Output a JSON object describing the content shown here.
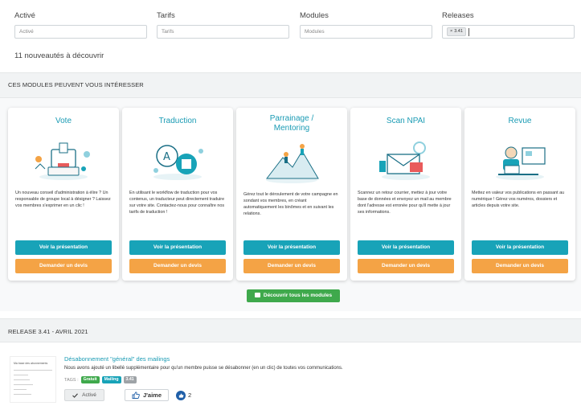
{
  "filters": [
    {
      "label": "Activé",
      "placeholder": "Activé"
    },
    {
      "label": "Tarifs",
      "placeholder": "Tarifs"
    },
    {
      "label": "Modules",
      "placeholder": "Modules"
    },
    {
      "label": "Releases",
      "chip": "3.41"
    }
  ],
  "count_text": "11 nouveautés à découvrir",
  "modules_section_title": "CES MODULES PEUVENT VOUS INTÉRESSER",
  "modules": [
    {
      "title": "Vote",
      "description": "Un nouveau conseil d'administration à élire ? Un responsable de groupe local à désigner ? Laissez vos membres s'exprimer en un clic !",
      "btn_presentation": "Voir la présentation",
      "btn_quote": "Demander un devis"
    },
    {
      "title": "Traduction",
      "description": "En utilisant le workflow de traduction pour vos contenus, un traducteur peut directement traduire sur votre site. Contactez-nous pour connaître nos tarifs de traduction !",
      "btn_presentation": "Voir la présentation",
      "btn_quote": "Demander un devis"
    },
    {
      "title_line1": "Parrainage /",
      "title_line2": "Mentoring",
      "description": "Gérez tout le déroulement de votre campagne en sondant vos membres, en créant automatiquement les binômes et en suivant les relations.",
      "btn_presentation": "Voir la présentation",
      "btn_quote": "Demander un devis"
    },
    {
      "title": "Scan NPAI",
      "description": "Scannez un retour courrier, mettez à jour votre base de données et envoyez un mail au membre dont l'adresse est erronée pour qu'il mette à jour ses informations.",
      "btn_presentation": "Voir la présentation",
      "btn_quote": "Demander un devis"
    },
    {
      "title": "Revue",
      "description": "Mettez en valeur vos publications en passant au numérique ! Gérez vos numéros, dossiers et articles depuis votre site.",
      "btn_presentation": "Voir la présentation",
      "btn_quote": "Demander un devis"
    }
  ],
  "discover_all_label": "Découvrir tous les modules",
  "release_section_title": "RELEASE 3.41 - AVRIL 2021",
  "release": {
    "thumb_title": "Ma base des abonnements",
    "title": "Désabonnement \"général\" des mailings",
    "description": "Nous avons ajouté un libellé supplémentaire pour qu'un membre puisse se désabonner (en un clic) de toutes vos communications.",
    "tags_label": "TAGS :",
    "tags": [
      "Gratuit",
      "Mailing",
      "3.41"
    ],
    "active_label": "Activé",
    "like_label": "J'aime",
    "like_count": "2"
  },
  "colors": {
    "accent": "#18a3b8",
    "orange": "#f4a345",
    "green": "#3fa94c",
    "link": "#1a9bb4"
  }
}
